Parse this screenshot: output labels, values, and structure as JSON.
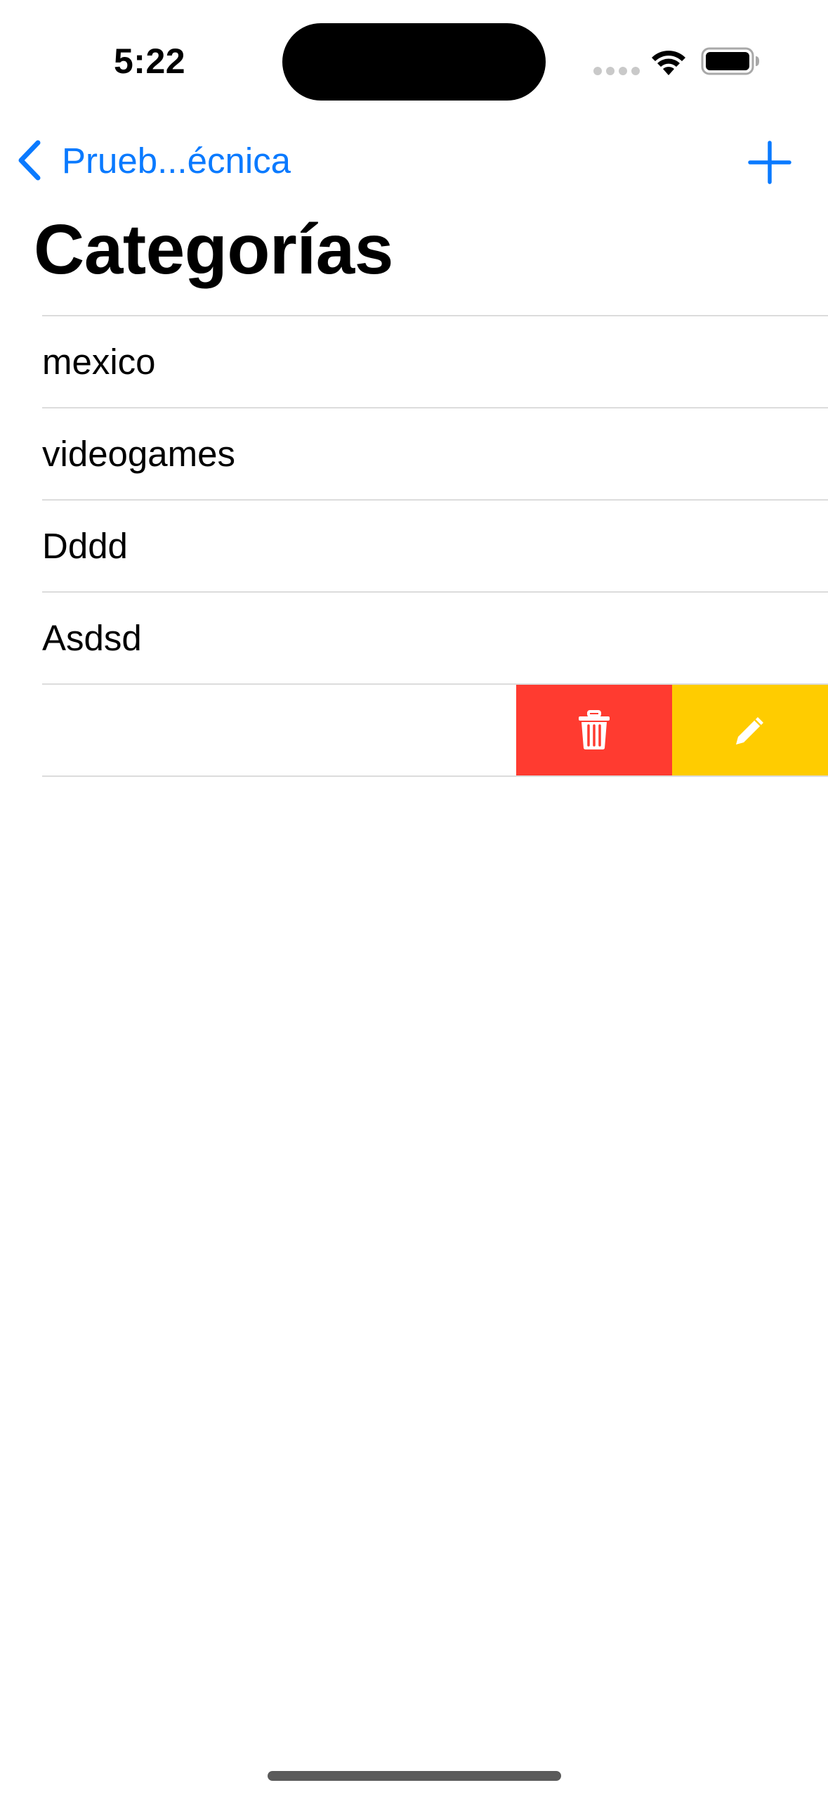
{
  "status_bar": {
    "time": "5:22"
  },
  "nav": {
    "back_label": "Prueb...écnica",
    "add_icon": "plus-icon",
    "back_icon": "chevron-left-icon"
  },
  "page": {
    "title": "Categorías"
  },
  "categories": [
    {
      "label": "mexico"
    },
    {
      "label": "videogames"
    },
    {
      "label": "Dddd"
    },
    {
      "label": "Asdsd"
    },
    {
      "label": ""
    }
  ],
  "swipe_actions": {
    "delete_icon": "trash-icon",
    "edit_icon": "pencil-icon"
  },
  "colors": {
    "accent": "#0a7aff",
    "delete": "#ff3b30",
    "edit": "#ffcc00"
  }
}
